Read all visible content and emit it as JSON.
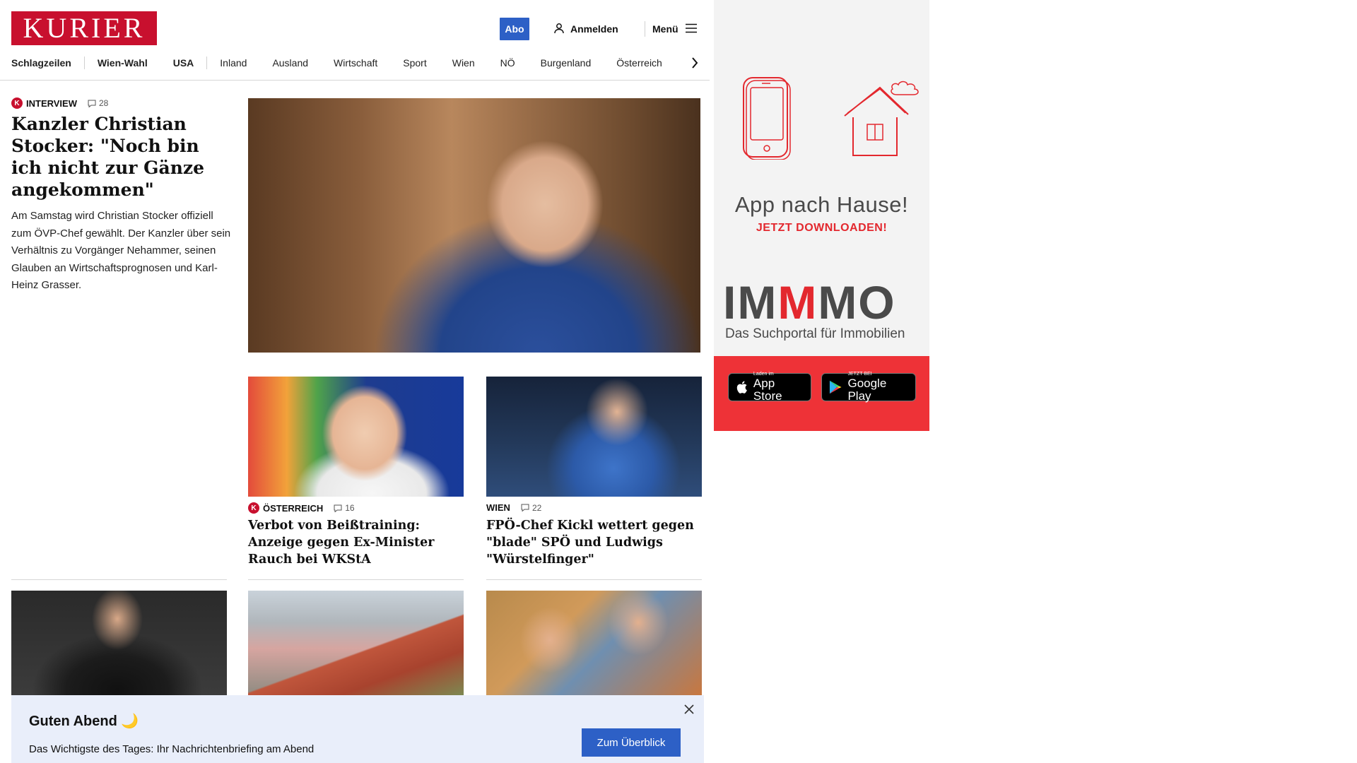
{
  "header": {
    "logo": "KURIER",
    "abo": "Abo",
    "login": "Anmelden",
    "menu": "Menü"
  },
  "nav": {
    "items": [
      "Schlagzeilen",
      "Wien-Wahl",
      "USA",
      "Inland",
      "Ausland",
      "Wirtschaft",
      "Sport",
      "Wien",
      "NÖ",
      "Burgenland",
      "Österreich"
    ]
  },
  "lead": {
    "category": "INTERVIEW",
    "comments": "28",
    "title": "Kanzler Christian Stocker: \"Noch bin ich nicht zur Gänze angekommen\"",
    "teaser": "Am Samstag wird Christian Stocker offiziell zum ÖVP-Chef gewählt. Der Kanzler über sein Verhältnis zu Vorgänger Nehammer, seinen Glauben an Wirtschaftsprognosen und Karl-Heinz Grasser."
  },
  "cards": [
    {
      "category": "ÖSTERREICH",
      "comments": "16",
      "premium": true,
      "title": "Verbot von Beißtraining: Anzeige gegen Ex-Minister Rauch bei WKStA"
    },
    {
      "category": "WIEN",
      "comments": "22",
      "premium": false,
      "title": "FPÖ-Chef Kickl wettert gegen \"blade\" SPÖ und Ludwigs \"Würstelfinger\""
    }
  ],
  "banner": {
    "title": "Guten Abend 🌙",
    "text": "Das Wichtigste des Tages: Ihr Nachrichtenbriefing am Abend",
    "button": "Zum Überblick"
  },
  "ad": {
    "headline": "App nach Hause!",
    "subline": "JETZT DOWNLOADEN!",
    "brand_a": "IM",
    "brand_m": "M",
    "brand_b": "MO",
    "tagline": "Das Suchportal für Immobilien",
    "apple_small": "Laden im",
    "apple_big": "App Store",
    "google_small": "JETZT BEI",
    "google_big": "Google Play",
    "accent": "#ee3237"
  },
  "colors": {
    "brand": "#c8102e",
    "button": "#2d60c6"
  }
}
